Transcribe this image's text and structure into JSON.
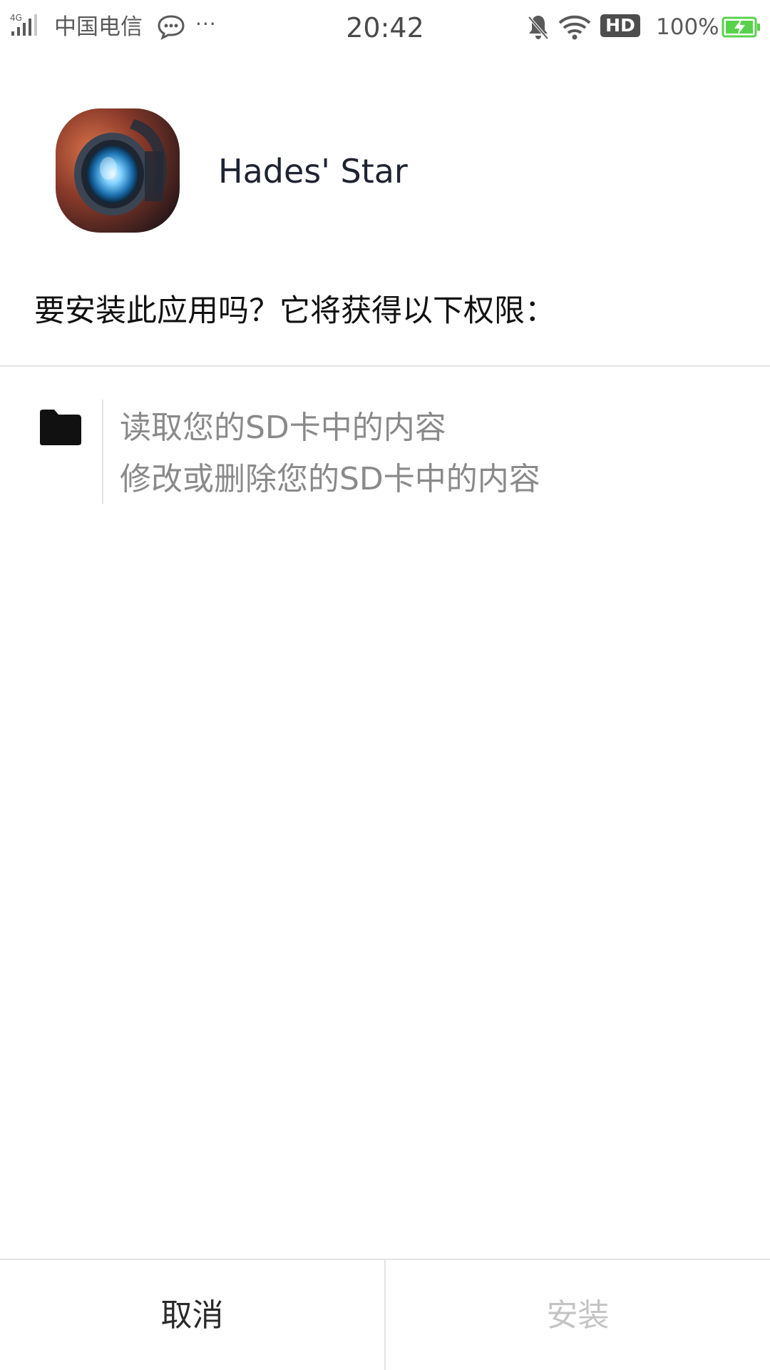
{
  "status_bar": {
    "network": "4G",
    "carrier": "中国电信",
    "more": "···",
    "time": "20:42",
    "hd": "HD",
    "battery_percent": "100%",
    "icons": [
      "signal-icon",
      "message-icon",
      "mute-icon",
      "wifi-icon",
      "battery-charging-icon"
    ]
  },
  "app": {
    "name": "Hades' Star",
    "icon": "app-icon"
  },
  "install_question": "要安装此应用吗？它将获得以下权限：",
  "permissions": {
    "group_icon": "folder-icon",
    "items": [
      "读取您的SD卡中的内容",
      "修改或删除您的SD卡中的内容"
    ]
  },
  "buttons": {
    "cancel": "取消",
    "install": "安装"
  },
  "colors": {
    "battery_green": "#57d24b",
    "install_disabled": "#c4c4c4",
    "permission_text": "#8a8a8a"
  }
}
